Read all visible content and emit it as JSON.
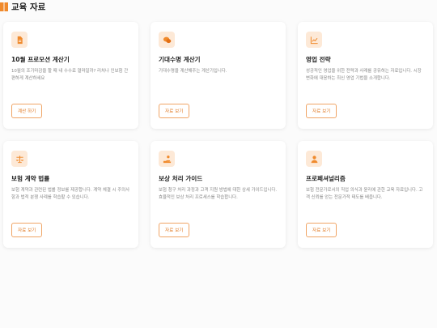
{
  "page": {
    "title": "교육 자료"
  },
  "colors": {
    "accent": "#f08a2c",
    "icon_bg": "#fde9d7"
  },
  "cards": [
    {
      "icon": "document-icon",
      "title": "10월 프로모션 계산기",
      "description": "10월의 조기마감을 할 때 내 수수료 얼마일까? 리치나 인보험 간편하게 계산하세요",
      "button": "계산 하기"
    },
    {
      "icon": "chat-bubbles-icon",
      "title": "기대수명 계산기",
      "description": "기대수명을 계산해주는 계산기입니다.",
      "button": "자료 보기"
    },
    {
      "icon": "chart-line-icon",
      "title": "영업 전략",
      "description": "성공적인 영업을 위한 전략과 사례를 공유하는 자료입니다. 시장 변화에 대응하는 최신 영업 기법을 소개합니다.",
      "button": "자료 보기"
    },
    {
      "icon": "scale-icon",
      "title": "보험 계약 법률",
      "description": "보험 계약과 관련된 법률 정보를 제공합니다. 계약 체결 시 주의사항과 법적 분쟁 사례를 학습할 수 있습니다.",
      "button": "자료 보기"
    },
    {
      "icon": "hand-coin-icon",
      "title": "보상 처리 가이드",
      "description": "보험 청구 처리 과정과 고객 지원 방법에 대한 상세 가이드입니다. 효율적인 보상 처리 프로세스를 학습합니다.",
      "button": "자료 보기"
    },
    {
      "icon": "person-badge-icon",
      "title": "프로페셔널리즘",
      "description": "보험 전문가로서의 직업 의식과 윤리에 관한 교육 자료입니다. 고객 신뢰를 얻는 전문가적 태도를 배웁니다.",
      "button": "자료 보기"
    }
  ]
}
